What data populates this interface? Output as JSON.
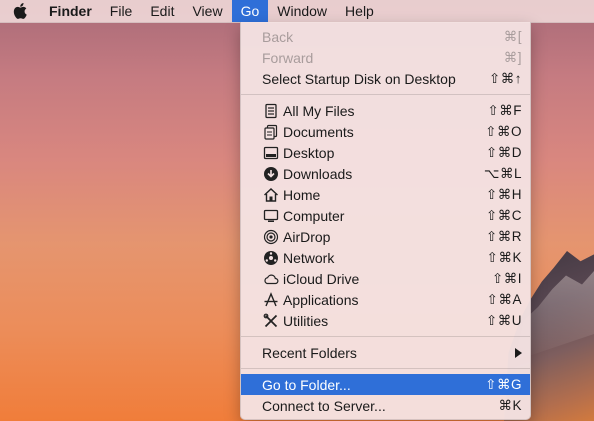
{
  "menubar": {
    "apple_icon": "apple-icon",
    "app_name": "Finder",
    "menus": [
      "File",
      "Edit",
      "View",
      "Go",
      "Window",
      "Help"
    ],
    "active_menu": "Go"
  },
  "go_menu": {
    "back": {
      "label": "Back",
      "shortcut": "⌘["
    },
    "forward": {
      "label": "Forward",
      "shortcut": "⌘]"
    },
    "startup_disk": {
      "label": "Select Startup Disk on Desktop",
      "shortcut": "⇧⌘↑"
    },
    "places": [
      {
        "label": "All My Files",
        "shortcut": "⇧⌘F",
        "icon": "all-files-icon"
      },
      {
        "label": "Documents",
        "shortcut": "⇧⌘O",
        "icon": "documents-icon"
      },
      {
        "label": "Desktop",
        "shortcut": "⇧⌘D",
        "icon": "desktop-icon"
      },
      {
        "label": "Downloads",
        "shortcut": "⌥⌘L",
        "icon": "downloads-icon"
      },
      {
        "label": "Home",
        "shortcut": "⇧⌘H",
        "icon": "home-icon"
      },
      {
        "label": "Computer",
        "shortcut": "⇧⌘C",
        "icon": "computer-icon"
      },
      {
        "label": "AirDrop",
        "shortcut": "⇧⌘R",
        "icon": "airdrop-icon"
      },
      {
        "label": "Network",
        "shortcut": "⇧⌘K",
        "icon": "network-icon"
      },
      {
        "label": "iCloud Drive",
        "shortcut": "⇧⌘I",
        "icon": "icloud-icon"
      },
      {
        "label": "Applications",
        "shortcut": "⇧⌘A",
        "icon": "applications-icon"
      },
      {
        "label": "Utilities",
        "shortcut": "⇧⌘U",
        "icon": "utilities-icon"
      }
    ],
    "recent_folders": {
      "label": "Recent Folders"
    },
    "go_to_folder": {
      "label": "Go to Folder...",
      "shortcut": "⇧⌘G"
    },
    "connect_to_server": {
      "label": "Connect to Server...",
      "shortcut": "⌘K"
    }
  }
}
